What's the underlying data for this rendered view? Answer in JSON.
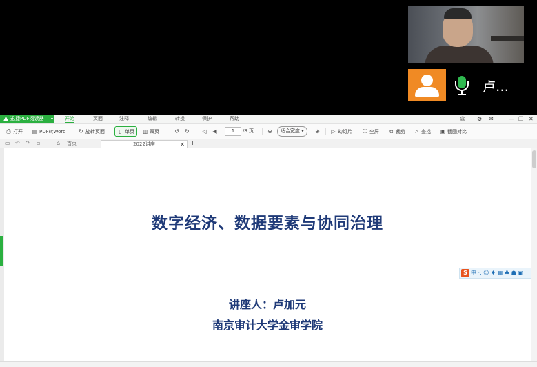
{
  "meeting": {
    "participant_name": "卢…",
    "avatar_icon": "user-icon",
    "mic_icon": "microphone-icon",
    "avatar_color": "#f08a24",
    "mic_color": "#2fb84f"
  },
  "app": {
    "name": "迅捷PDF阅读器",
    "accent_color": "#2bb040",
    "menu": [
      "开始",
      "页面",
      "注释",
      "编辑",
      "转换",
      "保护",
      "帮助"
    ],
    "window_controls": {
      "minimize": "—",
      "restore": "❐",
      "close": "✕"
    }
  },
  "toolbar": {
    "open_label": "打开",
    "pdf_to_word_label": "PDF转Word",
    "rotate_label": "旋转页面",
    "single_page_label": "单页",
    "double_page_label": "双页",
    "page_current": "1",
    "page_total": "/8 页",
    "fit_mode": "适合宽度",
    "play_label": "幻灯片",
    "fullscreen_label": "全屏",
    "crop_label": "裁剪",
    "find_label": "查找",
    "compare_label": "截图对比"
  },
  "tabs": {
    "home_label": "首页",
    "document_tab": "2022讲座"
  },
  "slide": {
    "title": "数字经济、数据要素与协同治理",
    "lecturer": "讲座人：卢加元",
    "institution": "南京审计大学金审学院",
    "title_color": "#1f3a78"
  },
  "ime": {
    "logo": "S",
    "items": "中 ·, ☺ ♦ ▦ ♣ ☗ ▣"
  }
}
